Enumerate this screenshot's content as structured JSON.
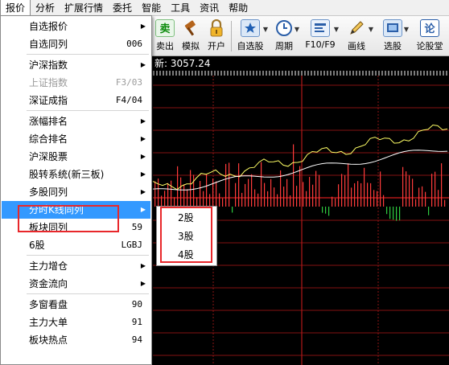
{
  "menubar": {
    "items": [
      "报价",
      "分析",
      "扩展行情",
      "委托",
      "智能",
      "工具",
      "资讯",
      "帮助"
    ]
  },
  "toolbar": {
    "left_partial": [
      "卖出",
      "模拟",
      "开户"
    ],
    "buttons": [
      "自选股",
      "周期",
      "F10/F9",
      "画线",
      "选股",
      "论股堂"
    ]
  },
  "status": {
    "latest_price": "新: 3057.24"
  },
  "dropdown": {
    "groups": [
      [
        {
          "label": "自选报价",
          "key": "",
          "submenu": true,
          "disabled": false
        },
        {
          "label": "自选同列",
          "key": "006",
          "submenu": false,
          "disabled": false
        }
      ],
      [
        {
          "label": "沪深指数",
          "key": "",
          "submenu": true,
          "disabled": false
        },
        {
          "label": "上证指数",
          "key": "F3/03",
          "submenu": false,
          "disabled": true
        },
        {
          "label": "深证成指",
          "key": "F4/04",
          "submenu": false,
          "disabled": false
        }
      ],
      [
        {
          "label": "涨幅排名",
          "key": "",
          "submenu": true,
          "disabled": false
        },
        {
          "label": "综合排名",
          "key": "",
          "submenu": true,
          "disabled": false
        },
        {
          "label": "沪深股票",
          "key": "",
          "submenu": true,
          "disabled": false
        },
        {
          "label": "股转系统(新三板)",
          "key": "",
          "submenu": true,
          "disabled": false
        },
        {
          "label": "多股同列",
          "key": "",
          "submenu": true,
          "disabled": false
        },
        {
          "label": "分时K线同列",
          "key": "",
          "submenu": true,
          "disabled": false,
          "highlighted": true
        },
        {
          "label": "板块同列",
          "key": "59",
          "submenu": false,
          "disabled": false
        },
        {
          "label": "6股",
          "key": "LGBJ",
          "submenu": false,
          "disabled": false
        }
      ],
      [
        {
          "label": "主力增仓",
          "key": "",
          "submenu": true,
          "disabled": false
        },
        {
          "label": "资金流向",
          "key": "",
          "submenu": true,
          "disabled": false
        }
      ],
      [
        {
          "label": "多窗看盘",
          "key": "90",
          "submenu": false,
          "disabled": false
        },
        {
          "label": "主力大单",
          "key": "91",
          "submenu": false,
          "disabled": false
        },
        {
          "label": "板块热点",
          "key": "94",
          "submenu": false,
          "disabled": false
        }
      ]
    ]
  },
  "submenu": {
    "items": [
      "2股",
      "3股",
      "4股"
    ]
  },
  "colors": {
    "grid": "#b01818",
    "price_line": "#ffffff",
    "avg_line": "#ffff66",
    "up_bar": "#ff3b3b",
    "down_bar": "#2ecc40",
    "highlight": "#3399ff",
    "annotation": "#e8272b"
  }
}
